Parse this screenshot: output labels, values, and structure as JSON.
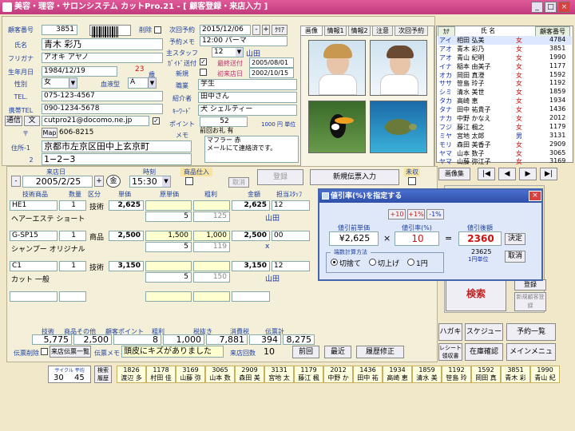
{
  "window": {
    "title": "美容・理容・サロンシステム カットPro.21 - [ 顧客登録・来店入力 ]"
  },
  "customer": {
    "id_label": "顧客番号",
    "id": "3851",
    "delete_label": "削除",
    "name_label": "氏名",
    "name": "青木 彩乃",
    "kana_label": "フリガナ",
    "kana": "アオキ アヤノ",
    "dob_label": "生年月日",
    "dob": "1984/12/19",
    "age": "23",
    "age_unit": "歳",
    "sex_label": "性別",
    "sex": "女",
    "blood_label": "血液型",
    "blood": "A",
    "tel_label": "TEL.",
    "tel": "075-123-4567",
    "mobile_label": "携帯TEL",
    "mobile": "090-1234-5678",
    "mail_label": "通信",
    "mail_btn": "文",
    "mail": "cutpro21@docomo.ne.jp",
    "zip_label": "〒",
    "map_btn": "Map",
    "zip": "606-8215",
    "addr1_label": "住所-1",
    "addr1": "京都市左京区田中上玄京町",
    "addr2_label": "2",
    "addr2": "1−2−3"
  },
  "visit_info": {
    "next_label": "次回予約",
    "next_date": "2015/12/06",
    "clear_btn": "ｸﾘｱ",
    "menu_label": "予約メモ",
    "menu": "12:00 パーマ",
    "staff_label": "主スタッフ",
    "staff_num": "12",
    "staff_name": "山田",
    "dm_label": "ｶﾞｲﾄﾞ送付",
    "last_visit_label": "最終送付",
    "last_visit": "2005/08/01",
    "new_label": "新規",
    "first_visit_label": "初来店日",
    "first_visit": "2002/10/15",
    "job_label": "職業",
    "job": "学生",
    "intro_label": "紹介者",
    "intro": "田中さん",
    "keyword_label": "ｷｰﾜｰﾄﾞ",
    "keyword": "犬 シェルティー",
    "point_label": "ポイント",
    "point": "52",
    "point_unit": "1000 円 単位",
    "memo_label": "メモ",
    "memo1": "前回お礼 有",
    "memo2": "マフラー 赤",
    "memo3": "メールにて連絡済です。"
  },
  "photo_tabs": [
    "画像",
    "情報1",
    "情報2",
    "注意",
    "次回予約"
  ],
  "customer_list": {
    "headers": [
      "ｶﾅ",
      "氏 名",
      "",
      "顧客番号"
    ],
    "rows": [
      [
        "アイ",
        "相田 弘美",
        "女",
        "4784"
      ],
      [
        "アオ",
        "青木 彩乃",
        "女",
        "3851"
      ],
      [
        "アオ",
        "青山 紀明",
        "女",
        "1990"
      ],
      [
        "イナ",
        "稲本 由美子",
        "女",
        "1177"
      ],
      [
        "オカ",
        "岡田 真澄",
        "女",
        "1592"
      ],
      [
        "ササ",
        "笹島 玲子",
        "女",
        "1192"
      ],
      [
        "シミ",
        "清水 美世",
        "女",
        "1859"
      ],
      [
        "タカ",
        "高崎 恵",
        "女",
        "1934"
      ],
      [
        "タナ",
        "田中 祐貴子",
        "女",
        "1436"
      ],
      [
        "ナカ",
        "中野 かなえ",
        "女",
        "2012"
      ],
      [
        "フジ",
        "藤江 楓之",
        "女",
        "1179"
      ],
      [
        "ミヤ",
        "宮地 太郎",
        "男",
        "3131"
      ],
      [
        "モリ",
        "森田 美香子",
        "女",
        "2909"
      ],
      [
        "ヤマ",
        "山本 数子",
        "女",
        "3065"
      ],
      [
        "ヤマ",
        "山藤 弥江子",
        "女",
        "3169"
      ]
    ],
    "image_btn": "画像集"
  },
  "visit": {
    "date_label": "来店日",
    "date": "2005/2/25",
    "day": "金",
    "time_label": "時刻",
    "time": "15:30",
    "product_label": "商品仕入",
    "register_btn": "登録",
    "cancel_btn": "取消",
    "new_slip_btn": "新規伝票入力",
    "unpaid_label": "未収"
  },
  "slip": {
    "headers": [
      "技術商品",
      "数量",
      "区分",
      "単価",
      "原単価",
      "粗利",
      "金額",
      "担当ｽﾀｯﾌ"
    ],
    "rows": [
      {
        "code": "HE1",
        "qty": "1",
        "cat": "技術",
        "price": "2,625",
        "cost": "",
        "profit": "",
        "amount": "2,625",
        "staff": "12",
        "name": "ヘアーエステ ショート",
        "sub_qty": "5",
        "sub_profit": "125",
        "staff_name": "山田"
      },
      {
        "code": "G-SP15",
        "qty": "1",
        "cat": "商品",
        "price": "2,500",
        "cost": "1,500",
        "profit": "1,000",
        "amount": "2,500",
        "staff": "00",
        "name": "シャンプー オリジナル",
        "sub_qty": "5",
        "sub_profit": "119",
        "staff_name": "x"
      },
      {
        "code": "C1",
        "qty": "1",
        "cat": "技術",
        "price": "3,150",
        "cost": "",
        "profit": "",
        "amount": "3,150",
        "staff": "12",
        "name": "カット 一般",
        "sub_qty": "5",
        "sub_profit": "150",
        "staff_name": "山田"
      }
    ]
  },
  "totals": {
    "headers": [
      "技術",
      "商品その他",
      "顧客ポイント",
      "粗利",
      "税抜き",
      "消費税",
      "伝票計"
    ],
    "values": [
      "5,775",
      "2,500",
      "8",
      "1,000",
      "7,881",
      "394",
      "8,275"
    ]
  },
  "bottom": {
    "delete_label": "伝票削除",
    "list_btn": "来店伝票一覧",
    "memo_label": "伝票メモ",
    "memo": "頭皮にキズがありました",
    "count_label": "来店回数",
    "count": "10",
    "prev_btn": "前回",
    "latest_btn": "最近",
    "history_btn": "履歴修正",
    "cycle_label": "サイクル 平均",
    "cycle1": "30",
    "cycle2": "45",
    "search_btn": "検索履歴"
  },
  "right_buttons": {
    "search_btn": "検索",
    "register_btn": "登録",
    "new_cust_btn": "新規顧客登録",
    "hagaki_btn": "ハガキ",
    "schedule_btn": "スケジュール",
    "reserve_btn": "予約一覧",
    "receipt_btn": "レシート領収書",
    "stock_btn": "在庫確認",
    "menu_btn": "メインメニュー"
  },
  "history_bar": [
    [
      "1826",
      "渡辺 多"
    ],
    [
      "1178",
      "村田 佳"
    ],
    [
      "3169",
      "山藤 弥"
    ],
    [
      "3065",
      "山本 数"
    ],
    [
      "2909",
      "森田 美"
    ],
    [
      "3131",
      "宮地 太"
    ],
    [
      "1179",
      "藤江 楓"
    ],
    [
      "2012",
      "中野 か"
    ],
    [
      "1436",
      "田中 祐"
    ],
    [
      "1934",
      "高崎 恵"
    ],
    [
      "1859",
      "清水 美"
    ],
    [
      "1192",
      "笹島 玲"
    ],
    [
      "1592",
      "岡田 真"
    ],
    [
      "3851",
      "青木 彩"
    ],
    [
      "1990",
      "青山 紀"
    ]
  ],
  "dialog": {
    "title": "値引率(%)を指定する",
    "step_btns": [
      "+10",
      "+1%",
      "-1%"
    ],
    "before_label": "値引前単価",
    "before": "¥2,625",
    "rate_label": "値引率(%)",
    "rate": "10",
    "after_label": "値引後額",
    "after": "2360",
    "decide_btn": "決定",
    "cancel_btn": "取消",
    "sub_value": "23625",
    "sub_unit": "1円単位",
    "method_label": "端数計算方法",
    "methods": [
      "切捨て",
      "切上げ",
      "1円"
    ]
  }
}
